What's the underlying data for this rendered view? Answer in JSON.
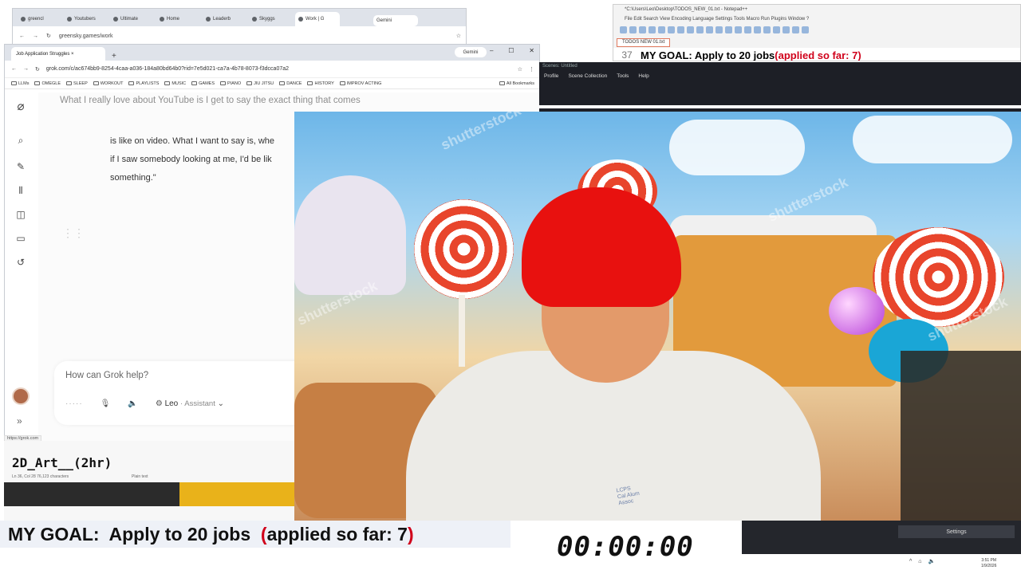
{
  "back_browser": {
    "tabs": [
      "greencl",
      "Youtubers",
      "Ultimate",
      "Home",
      "Leaderb",
      "Skyggs",
      "Work | G"
    ],
    "gemini_label": "Gemini",
    "url": "greensky.games/work"
  },
  "grok_browser": {
    "tab_title": "Job Application Struggles ×",
    "gemini_label": "Gemini",
    "url": "grok.com/c/ac674bb9-8254-4caa-a036-184a80bd64b0?rid=7e5d021-ca7a-4b78-8073-f3dcca07a2",
    "bookmarks": [
      "LLMs",
      "OMEGLE",
      "SLEEP",
      "WORKOUT",
      "PLAYLISTS",
      "MUSIC",
      "GAMES",
      "PIANO",
      "JIU JITSU",
      "DANCE",
      "HISTORY",
      "IMPROV ACTING"
    ],
    "bookmarks_right": "All Bookmarks"
  },
  "grok": {
    "faded_message": "What I really love about YouTube is I get to say the exact thing that comes",
    "bubble_lines": [
      "is like on video. What I want to say is, whe",
      "if I saw somebody looking at me, I'd be lik",
      "something.\""
    ],
    "composer_placeholder": "How can Grok help?",
    "voice_name": "Leo",
    "voice_mode": "· Assistant",
    "status_url": "https://grok.com"
  },
  "notepad_right": {
    "title": "*C:\\Users\\Leo\\Desktop\\TODOS_NEW_01.txt - Notepad++",
    "menu": "File  Edit  Search  View  Encoding  Language  Settings  Tools  Macro  Run  Plugins  Window  ?",
    "file_tab": "TODOS NEW 01.txt",
    "line_number": "37",
    "goal_text": "MY GOAL:  Apply to 20 jobs  ",
    "applied_text": "(applied so far: 7)"
  },
  "obs": {
    "title": "Scenes: Untitled",
    "menu": [
      "Profile",
      "Scene Collection",
      "Tools",
      "Help"
    ]
  },
  "webcam": {
    "watermarks": [
      "shutterstock",
      "shutterstock",
      "shutterstock",
      "shutterstock"
    ],
    "shirt_text": [
      "LCPS",
      "Cal Alum",
      "Assoc"
    ]
  },
  "notepad_left": {
    "title": "2D_Art__(2hr)",
    "status": "Ln 36, Col 28    76,123 characters",
    "status_right": "Plain text"
  },
  "goal_banner": {
    "goal_text": "MY GOAL:  Apply to 20 jobs  ",
    "open_paren": "(",
    "applied_text": "applied so far: 7",
    "close_paren": ")"
  },
  "timer": {
    "value": "00:00:00"
  },
  "taskbar": {
    "settings_label": "Settings",
    "clock_time": "3:51 PM",
    "clock_date": "1/9/2026"
  },
  "colors": {
    "accent_red": "#d0021b",
    "obs_dark": "#1d1f26"
  }
}
